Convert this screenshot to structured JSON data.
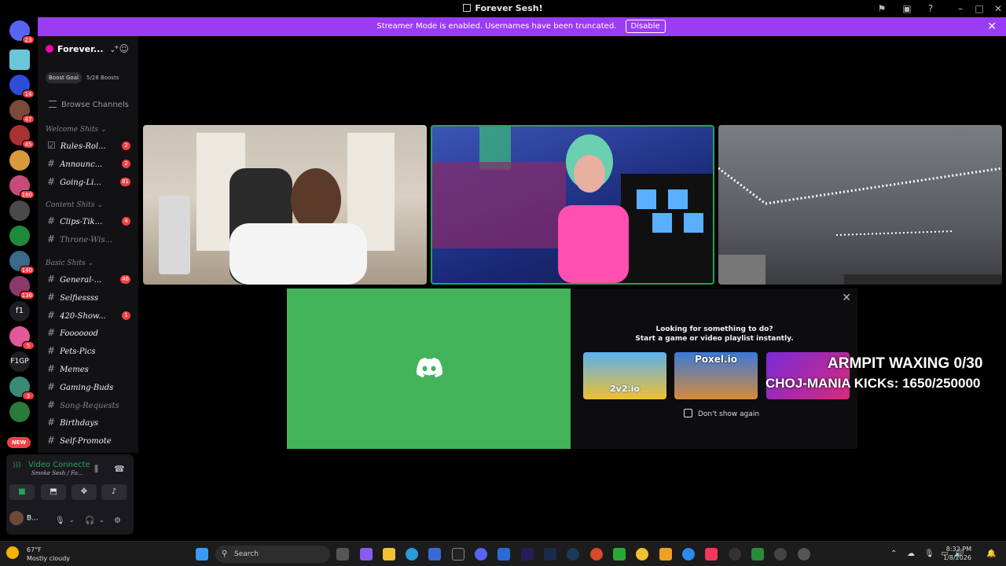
{
  "window": {
    "title": "Forever Sesh!"
  },
  "banner": {
    "message": "Streamer Mode is enabled. Usernames have been truncated.",
    "disable_label": "Disable"
  },
  "server_rail": {
    "badges": [
      "23",
      "14",
      "47",
      "45",
      "160",
      "140",
      "136",
      "5",
      "3"
    ],
    "text_items": [
      "f1",
      "F1GP"
    ],
    "new_label": "NEW"
  },
  "guild": {
    "name": "Forever...",
    "boost_label": "Boost Goal",
    "boost_count": "5/28 Boosts",
    "browse": "Browse Channels"
  },
  "categories": {
    "welcome": "Welcome Shits",
    "content": "Content Shits",
    "basic": "Basic Shits"
  },
  "channels": {
    "welcome": [
      {
        "name": "Rules-Rol...",
        "badge": "2"
      },
      {
        "name": "Announc...",
        "badge": "2"
      },
      {
        "name": "Going-Li...",
        "badge": "81"
      }
    ],
    "content": [
      {
        "name": "Clips-Tik...",
        "badge": "4"
      },
      {
        "name": "Throne-Wis...",
        "badge": ""
      }
    ],
    "basic": [
      {
        "name": "General-...",
        "badge": "46"
      },
      {
        "name": "Selfiessss",
        "badge": ""
      },
      {
        "name": "420-Show...",
        "badge": "1"
      },
      {
        "name": "Fooooood",
        "badge": ""
      },
      {
        "name": "Pets-Pics",
        "badge": ""
      },
      {
        "name": "Memes",
        "badge": ""
      },
      {
        "name": "Gaming-Buds",
        "badge": ""
      },
      {
        "name": "Song-Requests",
        "badge": ""
      },
      {
        "name": "Birthdays",
        "badge": ""
      },
      {
        "name": "Self-Promote",
        "badge": ""
      }
    ]
  },
  "voice": {
    "status": "Video Connecte",
    "location": "Smoke Sesh / Fo...",
    "user": "B..."
  },
  "activity": {
    "line1": "Looking for something to do?",
    "line2": "Start a game or video playlist instantly.",
    "games": [
      "2v2.io",
      "Poxel.io",
      ""
    ],
    "dont_show": "Don't show again"
  },
  "stream_overlay": {
    "line1": "ARMPIT WAXING 0/30",
    "line2": "CHOJ-MANIA KICKs: 1650/250000"
  },
  "taskbar": {
    "temp": "67°F",
    "weather": "Mostly cloudy",
    "search": "Search",
    "time": "8:32 PM",
    "date": "1/8/2026"
  }
}
